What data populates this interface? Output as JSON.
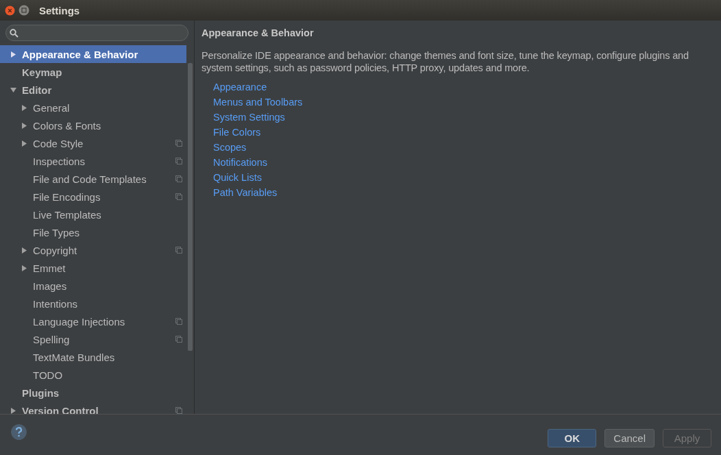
{
  "window": {
    "title": "Settings"
  },
  "sidebar": {
    "tree": [
      {
        "label": "Appearance & Behavior",
        "selected": true,
        "expanded": false,
        "project_level": false
      },
      {
        "label": "Keymap",
        "selected": false,
        "project_level": false
      },
      {
        "label": "Editor",
        "selected": false,
        "expanded": true,
        "project_level": false,
        "children": [
          {
            "label": "General",
            "selected": false,
            "expanded": false,
            "project_level": false
          },
          {
            "label": "Colors & Fonts",
            "selected": false,
            "expanded": false,
            "project_level": false
          },
          {
            "label": "Code Style",
            "selected": false,
            "expanded": false,
            "project_level": true
          },
          {
            "label": "Inspections",
            "selected": false,
            "project_level": true
          },
          {
            "label": "File and Code Templates",
            "selected": false,
            "project_level": true
          },
          {
            "label": "File Encodings",
            "selected": false,
            "project_level": true
          },
          {
            "label": "Live Templates",
            "selected": false,
            "project_level": false
          },
          {
            "label": "File Types",
            "selected": false,
            "project_level": false
          },
          {
            "label": "Copyright",
            "selected": false,
            "expanded": false,
            "project_level": true
          },
          {
            "label": "Emmet",
            "selected": false,
            "expanded": false,
            "project_level": false
          },
          {
            "label": "Images",
            "selected": false,
            "project_level": false
          },
          {
            "label": "Intentions",
            "selected": false,
            "project_level": false
          },
          {
            "label": "Language Injections",
            "selected": false,
            "project_level": true
          },
          {
            "label": "Spelling",
            "selected": false,
            "project_level": true
          },
          {
            "label": "TextMate Bundles",
            "selected": false,
            "project_level": false
          },
          {
            "label": "TODO",
            "selected": false,
            "project_level": false
          }
        ]
      },
      {
        "label": "Plugins",
        "selected": false,
        "project_level": false
      },
      {
        "label": "Version Control",
        "selected": false,
        "expanded": false,
        "project_level": true
      }
    ]
  },
  "content": {
    "title": "Appearance & Behavior",
    "description": "Personalize IDE appearance and behavior: change themes and font size, tune the keymap, configure plugins and system settings, such as password policies, HTTP proxy, updates and more.",
    "links": [
      "Appearance",
      "Menus and Toolbars",
      "System Settings",
      "File Colors",
      "Scopes",
      "Notifications",
      "Quick Lists",
      "Path Variables"
    ]
  },
  "buttons": [
    {
      "label": "OK",
      "default": true,
      "disabled": false
    },
    {
      "label": "Cancel",
      "default": false,
      "disabled": false
    },
    {
      "label": "Apply",
      "default": false,
      "disabled": true
    }
  ]
}
